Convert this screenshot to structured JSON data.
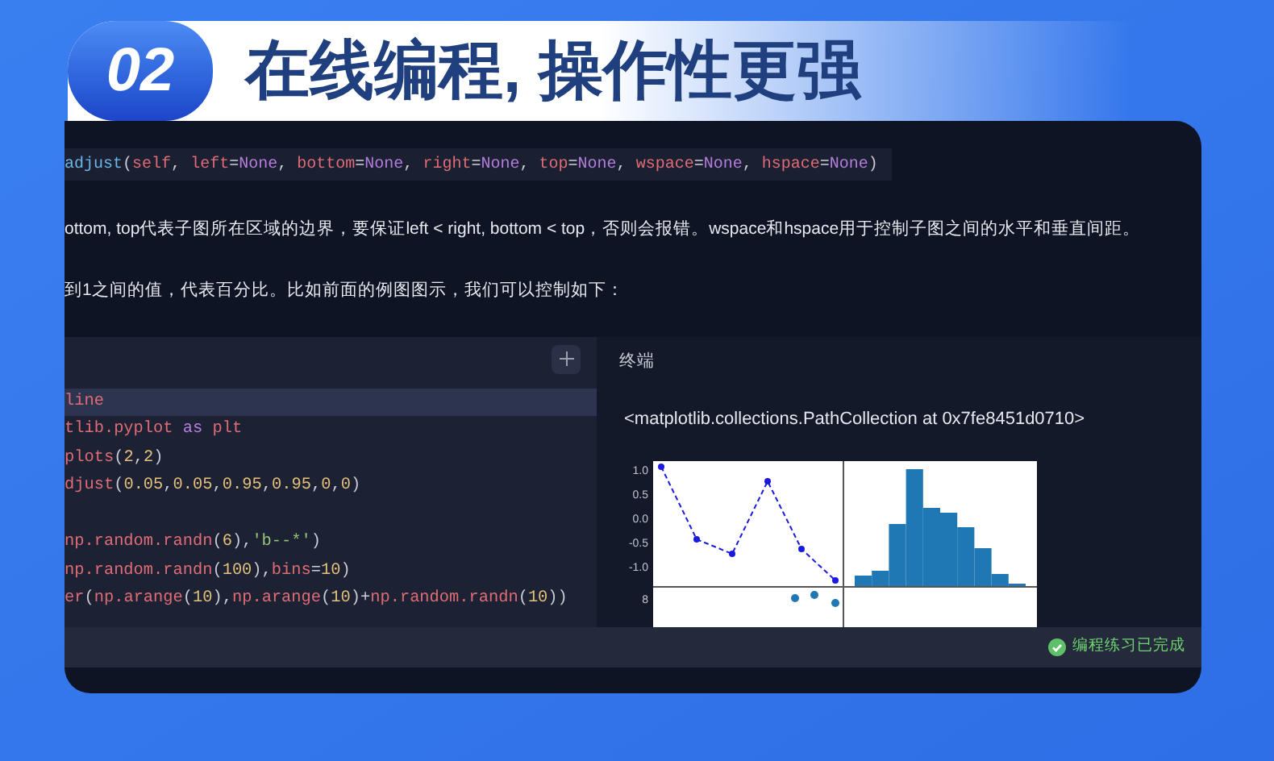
{
  "banner": {
    "number": "02",
    "title": "在线编程, 操作性更强"
  },
  "signature": [
    {
      "kind": "fn",
      "text": "adjust"
    },
    {
      "kind": "op",
      "text": "("
    },
    {
      "kind": "param",
      "text": "self"
    },
    {
      "kind": "op",
      "text": ", "
    },
    {
      "kind": "param",
      "text": "left"
    },
    {
      "kind": "op",
      "text": "="
    },
    {
      "kind": "kw",
      "text": "None"
    },
    {
      "kind": "op",
      "text": ", "
    },
    {
      "kind": "param",
      "text": "bottom"
    },
    {
      "kind": "op",
      "text": "="
    },
    {
      "kind": "kw",
      "text": "None"
    },
    {
      "kind": "op",
      "text": ", "
    },
    {
      "kind": "param",
      "text": "right"
    },
    {
      "kind": "op",
      "text": "="
    },
    {
      "kind": "kw",
      "text": "None"
    },
    {
      "kind": "op",
      "text": ", "
    },
    {
      "kind": "param",
      "text": "top"
    },
    {
      "kind": "op",
      "text": "="
    },
    {
      "kind": "kw",
      "text": "None"
    },
    {
      "kind": "op",
      "text": ", "
    },
    {
      "kind": "param",
      "text": "wspace"
    },
    {
      "kind": "op",
      "text": "="
    },
    {
      "kind": "kw",
      "text": "None"
    },
    {
      "kind": "op",
      "text": ", "
    },
    {
      "kind": "param",
      "text": "hspace"
    },
    {
      "kind": "op",
      "text": "="
    },
    {
      "kind": "kw",
      "text": "None"
    },
    {
      "kind": "op",
      "text": ")"
    }
  ],
  "paragraphs": [
    "ottom, top代表子图所在区域的边界，要保证left < right, bottom < top，否则会报错。wspace和hspace用于控制子图之间的水平和垂直间距。",
    "到1之间的值，代表百分比。比如前面的例图图示，我们可以控制如下："
  ],
  "editor": {
    "lines": [
      {
        "kind": "code",
        "current": true,
        "tokens": [
          {
            "kind": "param",
            "text": "line"
          }
        ]
      },
      {
        "kind": "code",
        "current": false,
        "tokens": [
          {
            "kind": "param",
            "text": "tlib.pyplot "
          },
          {
            "kind": "kw",
            "text": "as"
          },
          {
            "kind": "param",
            "text": " plt"
          }
        ]
      },
      {
        "kind": "code",
        "current": false,
        "tokens": [
          {
            "kind": "param",
            "text": "plots"
          },
          {
            "kind": "op",
            "text": "("
          },
          {
            "kind": "num",
            "text": "2"
          },
          {
            "kind": "op",
            "text": ","
          },
          {
            "kind": "num",
            "text": "2"
          },
          {
            "kind": "op",
            "text": ")"
          }
        ]
      },
      {
        "kind": "code",
        "current": false,
        "tokens": [
          {
            "kind": "param",
            "text": "djust"
          },
          {
            "kind": "op",
            "text": "("
          },
          {
            "kind": "num",
            "text": "0.05"
          },
          {
            "kind": "op",
            "text": ","
          },
          {
            "kind": "num",
            "text": "0.05"
          },
          {
            "kind": "op",
            "text": ","
          },
          {
            "kind": "num",
            "text": "0.95"
          },
          {
            "kind": "op",
            "text": ","
          },
          {
            "kind": "num",
            "text": "0.95"
          },
          {
            "kind": "op",
            "text": ","
          },
          {
            "kind": "num",
            "text": "0"
          },
          {
            "kind": "op",
            "text": ","
          },
          {
            "kind": "num",
            "text": "0"
          },
          {
            "kind": "op",
            "text": ")"
          }
        ]
      },
      {
        "kind": "blank"
      },
      {
        "kind": "code",
        "current": false,
        "tokens": [
          {
            "kind": "param",
            "text": "np.random.randn"
          },
          {
            "kind": "op",
            "text": "("
          },
          {
            "kind": "num",
            "text": "6"
          },
          {
            "kind": "op",
            "text": "),"
          },
          {
            "kind": "str",
            "text": "'b--*'"
          },
          {
            "kind": "op",
            "text": ")"
          }
        ]
      },
      {
        "kind": "code",
        "current": false,
        "tokens": [
          {
            "kind": "param",
            "text": "np.random.randn"
          },
          {
            "kind": "op",
            "text": "("
          },
          {
            "kind": "num",
            "text": "100"
          },
          {
            "kind": "op",
            "text": "),"
          },
          {
            "kind": "param",
            "text": "bins"
          },
          {
            "kind": "op",
            "text": "="
          },
          {
            "kind": "num",
            "text": "10"
          },
          {
            "kind": "op",
            "text": ")"
          }
        ]
      },
      {
        "kind": "code",
        "current": false,
        "tokens": [
          {
            "kind": "param",
            "text": "er"
          },
          {
            "kind": "op",
            "text": "("
          },
          {
            "kind": "param",
            "text": "np.arange"
          },
          {
            "kind": "op",
            "text": "("
          },
          {
            "kind": "num",
            "text": "10"
          },
          {
            "kind": "op",
            "text": "),"
          },
          {
            "kind": "param",
            "text": "np.arange"
          },
          {
            "kind": "op",
            "text": "("
          },
          {
            "kind": "num",
            "text": "10"
          },
          {
            "kind": "op",
            "text": ")+"
          },
          {
            "kind": "param",
            "text": "np.random.randn"
          },
          {
            "kind": "op",
            "text": "("
          },
          {
            "kind": "num",
            "text": "10"
          },
          {
            "kind": "op",
            "text": "))"
          }
        ]
      }
    ]
  },
  "terminal": {
    "title": "终端",
    "output": "<matplotlib.collections.PathCollection at 0x7fe8451d0710>",
    "plot": {
      "ticks": [
        "1.0",
        "0.5",
        "0.0",
        "-0.5",
        "-1.0",
        "8"
      ]
    }
  },
  "status": {
    "text": "编程练习已完成",
    "done": true
  }
}
